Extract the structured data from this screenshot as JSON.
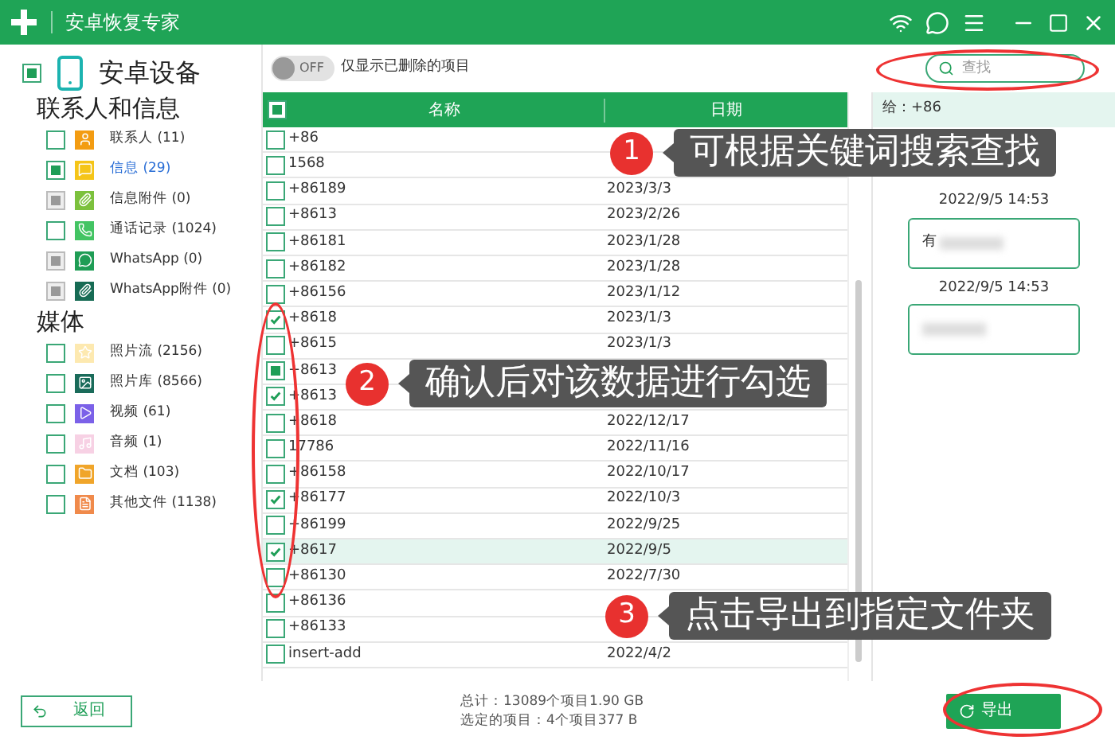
{
  "window": {
    "title": "安卓恢复专家"
  },
  "device": {
    "label": "安卓设备",
    "partial": true
  },
  "sections": [
    {
      "title": "联系人和信息",
      "items": [
        {
          "label": "联系人 (11)",
          "checked": false,
          "partial": false,
          "disabled": false,
          "selected": false
        },
        {
          "label": "信息 (29)",
          "checked": false,
          "partial": true,
          "disabled": false,
          "selected": true
        },
        {
          "label": "信息附件 (0)",
          "checked": false,
          "partial": true,
          "disabled": true,
          "selected": false
        },
        {
          "label": "通话记录 (1024)",
          "checked": false,
          "partial": false,
          "disabled": false,
          "selected": false
        },
        {
          "label": "WhatsApp (0)",
          "checked": false,
          "partial": true,
          "disabled": true,
          "selected": false
        },
        {
          "label": "WhatsApp附件 (0)",
          "checked": false,
          "partial": true,
          "disabled": true,
          "selected": false
        }
      ]
    },
    {
      "title": "媒体",
      "items": [
        {
          "label": "照片流 (2156)",
          "checked": false,
          "partial": false,
          "disabled": false,
          "selected": false
        },
        {
          "label": "照片库 (8566)",
          "checked": false,
          "partial": false,
          "disabled": false,
          "selected": false
        },
        {
          "label": "视频 (61)",
          "checked": false,
          "partial": false,
          "disabled": false,
          "selected": false
        },
        {
          "label": "音频 (1)",
          "checked": false,
          "partial": false,
          "disabled": false,
          "selected": false
        },
        {
          "label": "文档 (103)",
          "checked": false,
          "partial": false,
          "disabled": false,
          "selected": false
        },
        {
          "label": "其他文件 (1138)",
          "checked": false,
          "partial": false,
          "disabled": false,
          "selected": false
        }
      ]
    }
  ],
  "filter": {
    "toggle": "OFF",
    "on": false,
    "label": "仅显示已删除的项目"
  },
  "search": {
    "placeholder": "查找"
  },
  "table": {
    "header_partial": true,
    "columns": [
      "名称",
      "日期"
    ],
    "rows": [
      {
        "name": "+86",
        "checked": false,
        "partial": false,
        "selected": false
      },
      {
        "name": "1568",
        "checked": false,
        "partial": false,
        "selected": false
      },
      {
        "name": "+86189",
        "date": "2023/3/3",
        "checked": false,
        "partial": false,
        "selected": false
      },
      {
        "name": "+8613",
        "date": "2023/2/26",
        "checked": false,
        "partial": false,
        "selected": false
      },
      {
        "name": "+86181",
        "date": "2023/1/28",
        "checked": false,
        "partial": false,
        "selected": false
      },
      {
        "name": "+86182",
        "date": "2023/1/28",
        "checked": false,
        "partial": false,
        "selected": false
      },
      {
        "name": "+86156",
        "date": "2023/1/12",
        "checked": false,
        "partial": false,
        "selected": false
      },
      {
        "name": "+8618",
        "date": "2023/1/3",
        "checked": true,
        "partial": false,
        "selected": false
      },
      {
        "name": "+8615",
        "date": "2023/1/3",
        "checked": false,
        "partial": false,
        "selected": false
      },
      {
        "name": "+8613",
        "checked": false,
        "partial": true,
        "selected": false
      },
      {
        "name": "+8613",
        "checked": true,
        "partial": false,
        "selected": false
      },
      {
        "name": "+8618",
        "date": "2022/12/17",
        "checked": false,
        "partial": false,
        "selected": false
      },
      {
        "name": "17786",
        "date": "2022/11/16",
        "checked": false,
        "partial": false,
        "selected": false
      },
      {
        "name": "+86158",
        "date": "2022/10/17",
        "checked": false,
        "partial": false,
        "selected": false
      },
      {
        "name": "+86177",
        "date": "2022/10/3",
        "checked": true,
        "partial": false,
        "selected": false
      },
      {
        "name": "+86199",
        "date": "2022/9/25",
        "checked": false,
        "partial": false,
        "selected": false
      },
      {
        "name": "+8617",
        "date": "2022/9/5",
        "checked": true,
        "partial": false,
        "selected": true
      },
      {
        "name": "+86130",
        "date": "2022/7/30",
        "checked": false,
        "partial": false,
        "selected": false
      },
      {
        "name": "+86136",
        "checked": false,
        "partial": false,
        "selected": false
      },
      {
        "name": "+86133",
        "checked": false,
        "partial": false,
        "selected": false
      },
      {
        "name": "insert-add",
        "date": "2022/4/2",
        "checked": false,
        "partial": false,
        "selected": false
      }
    ]
  },
  "preview": {
    "to": "给：+86",
    "messages": [
      {
        "time": "2022/9/5 14:53",
        "text": "有"
      },
      {
        "time": "2022/9/5 14:53"
      }
    ]
  },
  "callouts": [
    {
      "number": "1",
      "text": "可根据关键词搜索查找"
    },
    {
      "number": "2",
      "text": "确认后对该数据进行勾选"
    },
    {
      "number": "3",
      "text": "点击导出到指定文件夹"
    }
  ],
  "footer": {
    "back": "返回",
    "total": "总计：13089个项目1.90 GB",
    "selected_info": "选定的项目：4个项目377 B",
    "export": "导出"
  }
}
